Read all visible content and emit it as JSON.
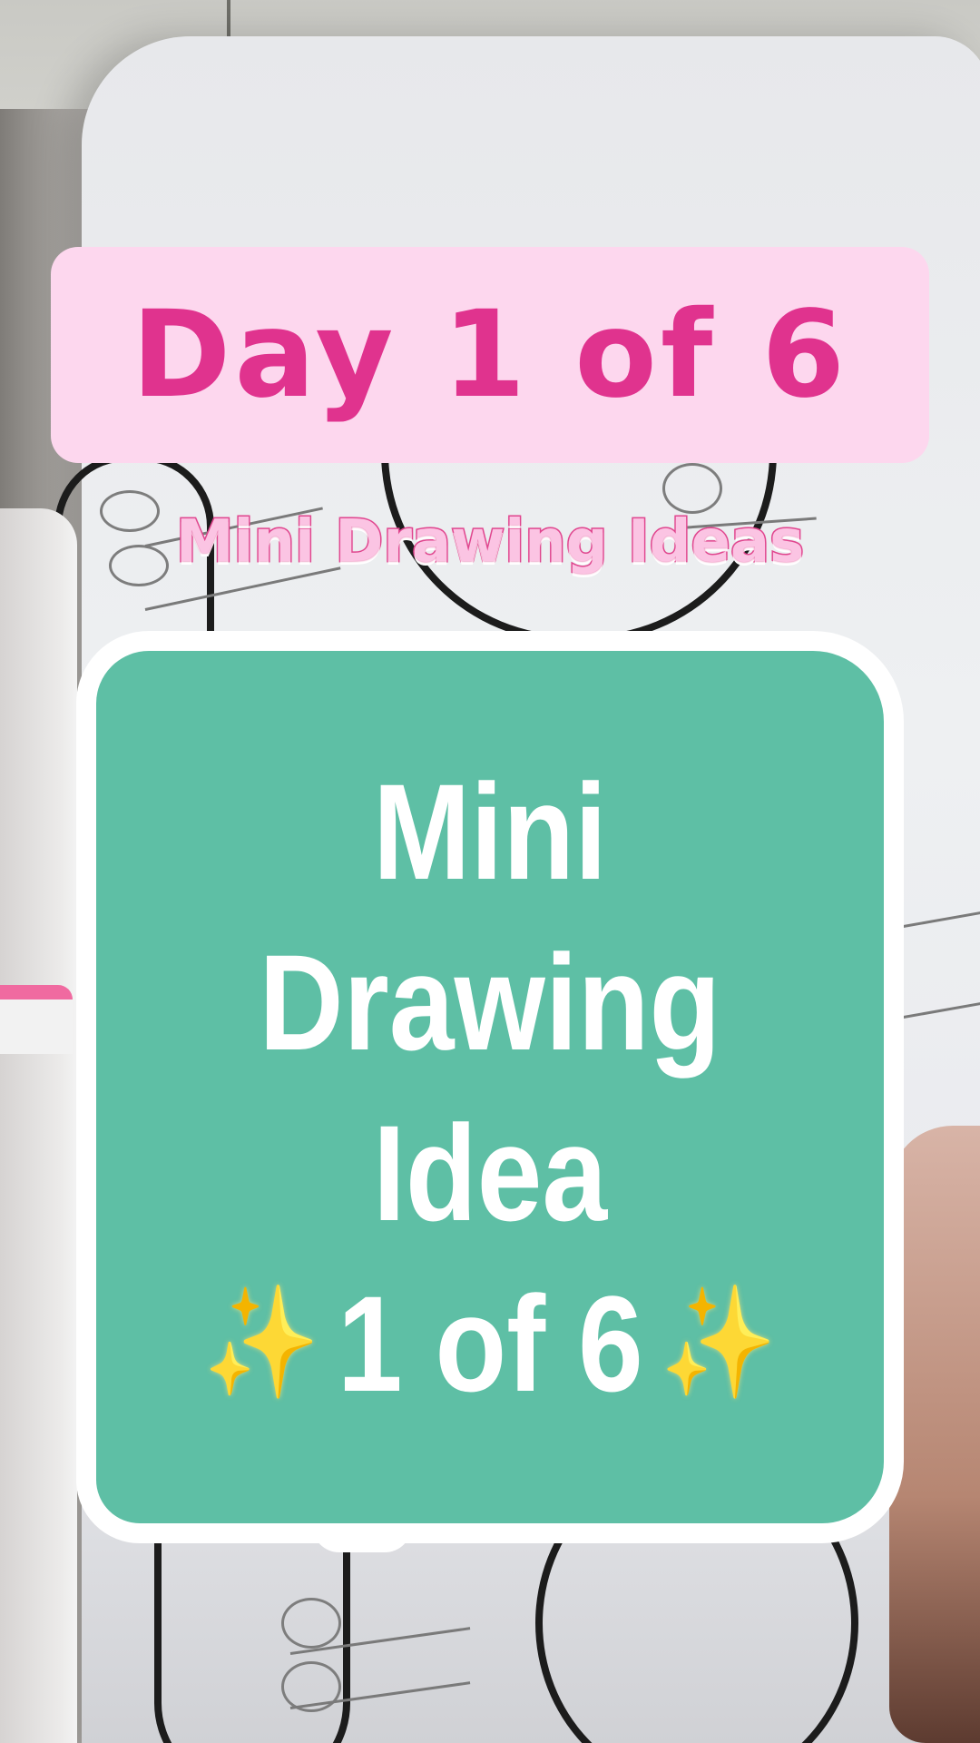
{
  "banner": {
    "title": "Day 1 of 6"
  },
  "subtitle": "Mini Drawing Ideas",
  "card": {
    "lines": [
      "Mini",
      "Drawing",
      "Idea"
    ],
    "count_text": "1 of 6",
    "left_icon": "sparkles-icon",
    "right_icon": "sparkles-icon",
    "sparkle_glyph": "✦✧",
    "background_color": "#5ebfa5"
  },
  "colors": {
    "banner_background": "#fdd7ee",
    "banner_text": "#e0338e",
    "subtitle_fill": "#fbc4e3",
    "subtitle_stroke": "#e0478f"
  }
}
